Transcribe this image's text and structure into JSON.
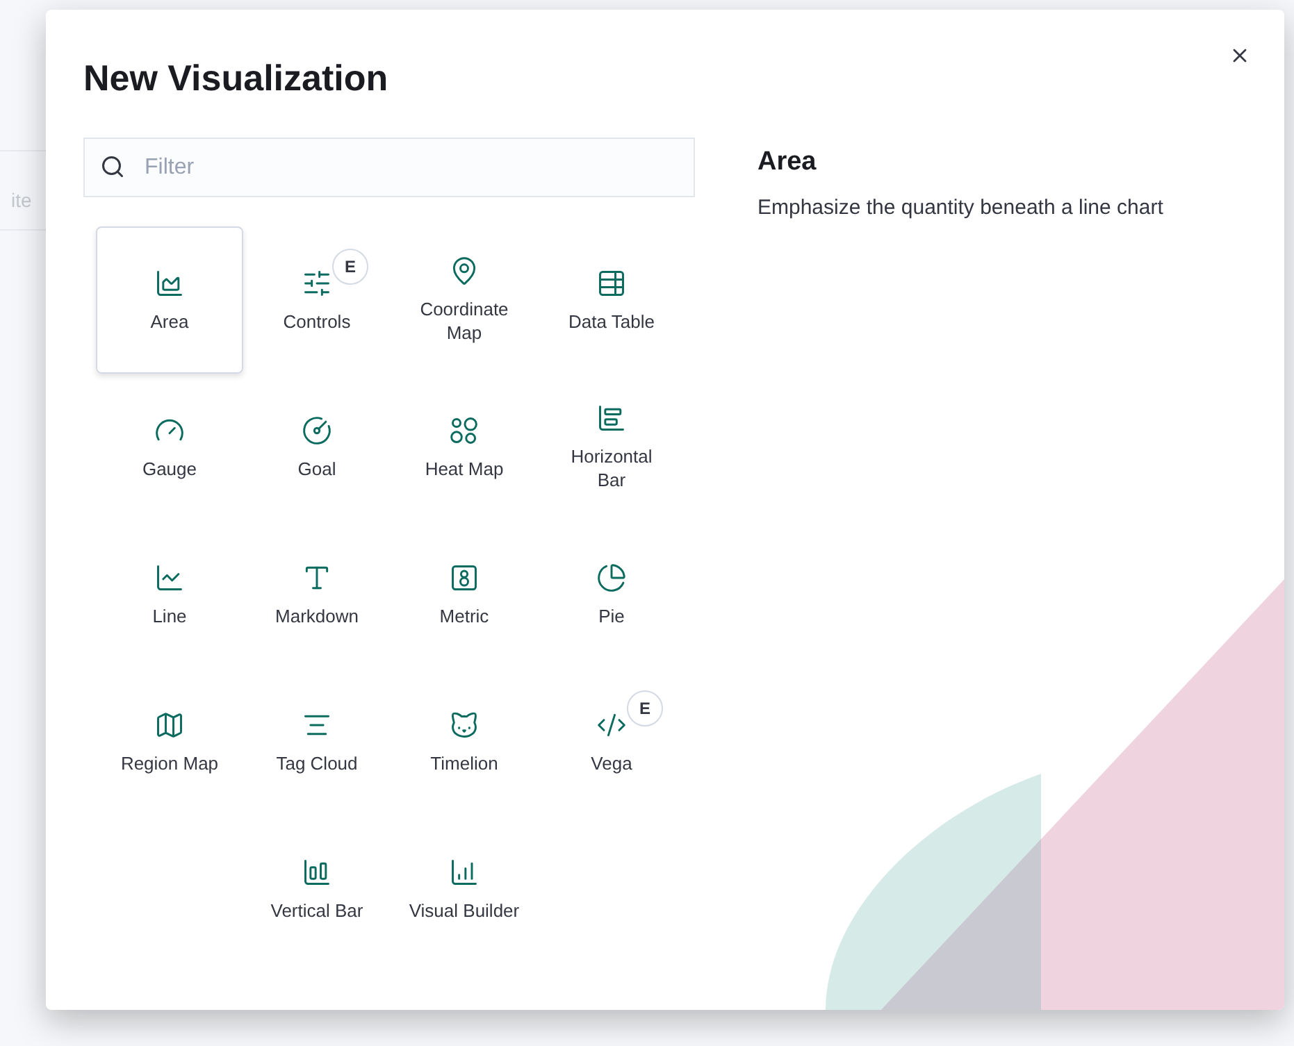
{
  "background_text": "ite",
  "modal": {
    "title": "New Visualization",
    "search": {
      "placeholder": "Filter"
    },
    "items": [
      {
        "label": "Area",
        "selected": true
      },
      {
        "label": "Controls",
        "selected": false,
        "badge": "E"
      },
      {
        "label": "Coordinate Map",
        "selected": false
      },
      {
        "label": "Data Table",
        "selected": false
      },
      {
        "label": "Gauge",
        "selected": false
      },
      {
        "label": "Goal",
        "selected": false
      },
      {
        "label": "Heat Map",
        "selected": false
      },
      {
        "label": "Horizontal Bar",
        "selected": false
      },
      {
        "label": "Line",
        "selected": false
      },
      {
        "label": "Markdown",
        "selected": false
      },
      {
        "label": "Metric",
        "selected": false
      },
      {
        "label": "Pie",
        "selected": false
      },
      {
        "label": "Region Map",
        "selected": false
      },
      {
        "label": "Tag Cloud",
        "selected": false
      },
      {
        "label": "Timelion",
        "selected": false
      },
      {
        "label": "Vega",
        "selected": false,
        "badge": "E"
      },
      {
        "label": "Vertical Bar",
        "selected": false
      },
      {
        "label": "Visual Builder",
        "selected": false
      }
    ],
    "detail": {
      "title": "Area",
      "description": "Emphasize the quantity beneath a line chart"
    }
  }
}
